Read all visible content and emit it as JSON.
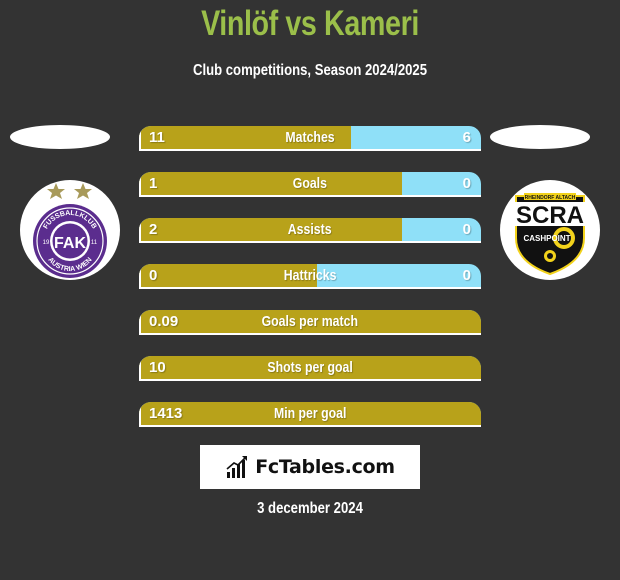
{
  "header": {
    "title": "Vinlöf vs Kameri",
    "subtitle": "Club competitions, Season 2024/2025"
  },
  "teams": {
    "left": {
      "name": "Austria Wien",
      "logo_icon": "fk-austria-wien-crest-icon",
      "badge_text_top": "FUSSBALLKLUB",
      "badge_text_bottom": "AUSTRIA WIEN",
      "badge_initials": "FAK",
      "year_left": "19",
      "year_right": "11"
    },
    "right": {
      "name": "SCR Altach",
      "logo_icon": "scr-altach-crest-icon",
      "badge_text": "SCRA",
      "badge_banner": "RHEINDORF ALTACH",
      "badge_sponsor": "CASHPOINT"
    }
  },
  "colors": {
    "title": "#9bbf4a",
    "left_bar": "#b8a21a",
    "right_bar": "#8fe0f8",
    "background": "#333333"
  },
  "stats": [
    {
      "label": "Matches",
      "left": "11",
      "right": "6",
      "left_share": 0.62
    },
    {
      "label": "Goals",
      "left": "1",
      "right": "0",
      "left_share": 0.77
    },
    {
      "label": "Assists",
      "left": "2",
      "right": "0",
      "left_share": 0.77
    },
    {
      "label": "Hattricks",
      "left": "0",
      "right": "0",
      "left_share": 0.52
    },
    {
      "label": "Goals per match",
      "left": "0.09",
      "right": "",
      "left_share": 1.0
    },
    {
      "label": "Shots per goal",
      "left": "10",
      "right": "",
      "left_share": 1.0
    },
    {
      "label": "Min per goal",
      "left": "1413",
      "right": "",
      "left_share": 1.0
    }
  ],
  "footer": {
    "brand": "FcTables.com",
    "brand_icon": "bar-chart-icon",
    "date": "3 december 2024"
  }
}
